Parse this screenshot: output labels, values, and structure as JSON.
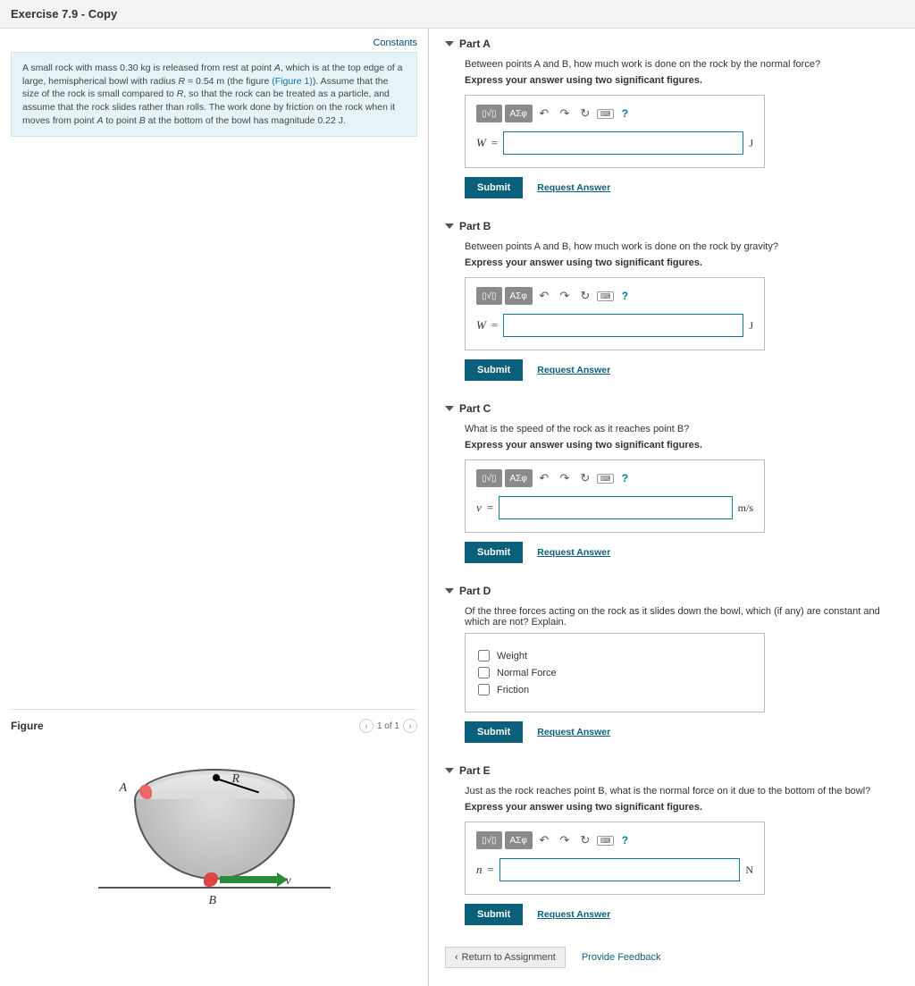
{
  "page_title": "Exercise 7.9 - Copy",
  "constants_link": "Constants",
  "problem_text_parts": {
    "t1": "A small rock with mass 0.30 ",
    "u1": "kg",
    "t2": " is released from rest at point ",
    "vA": "A",
    "t3": ", which is at the top edge of a large, hemispherical bowl with radius ",
    "vR": "R",
    "t4": " = 0.54 ",
    "u2": "m",
    "t5": " (the figure ",
    "figlink": "(Figure 1)",
    "t6": "). Assume that the size of the rock is small compared to ",
    "t7": ", so that the rock can be treated as a particle, and assume that the rock slides rather than rolls. The work done by friction on the rock when it moves from point ",
    "t8": " to point ",
    "vB": "B",
    "t9": " at the bottom of the bowl has magnitude 0.22 ",
    "u3": "J",
    "t10": "."
  },
  "figure": {
    "title": "Figure",
    "pager": "1 of 1",
    "labels": {
      "A": "A",
      "R": "R",
      "B": "B",
      "v": "v"
    }
  },
  "toolbar": {
    "templates": "▯√▯",
    "greek": "ΑΣφ",
    "undo": "↶",
    "redo": "↷",
    "reset": "↻",
    "keyboard": "⌨",
    "help": "?"
  },
  "parts": {
    "A": {
      "title": "Part A",
      "question": "Between points A and B, how much work is done on the rock by the normal force?",
      "instruction": "Express your answer using two significant figures.",
      "variable": "W",
      "unit": "J"
    },
    "B": {
      "title": "Part B",
      "question": "Between points A and B, how much work is done on the rock by gravity?",
      "instruction": "Express your answer using two significant figures.",
      "variable": "W",
      "unit": "J"
    },
    "C": {
      "title": "Part C",
      "question": "What is the speed of the rock as it reaches point B?",
      "instruction": "Express your answer using two significant figures.",
      "variable": "v",
      "unit": "m/s"
    },
    "D": {
      "title": "Part D",
      "question": "Of the three forces acting on the rock as it slides down the bowl, which (if any) are constant and which are not? Explain.",
      "choices": [
        "Weight",
        "Normal Force",
        "Friction"
      ]
    },
    "E": {
      "title": "Part E",
      "question": "Just as the rock reaches point B, what is the normal force on it due to the bottom of the bowl?",
      "instruction": "Express your answer using two significant figures.",
      "variable": "n",
      "unit": "N"
    }
  },
  "buttons": {
    "submit": "Submit",
    "request": "Request Answer",
    "return": "Return to Assignment",
    "feedback": "Provide Feedback"
  }
}
